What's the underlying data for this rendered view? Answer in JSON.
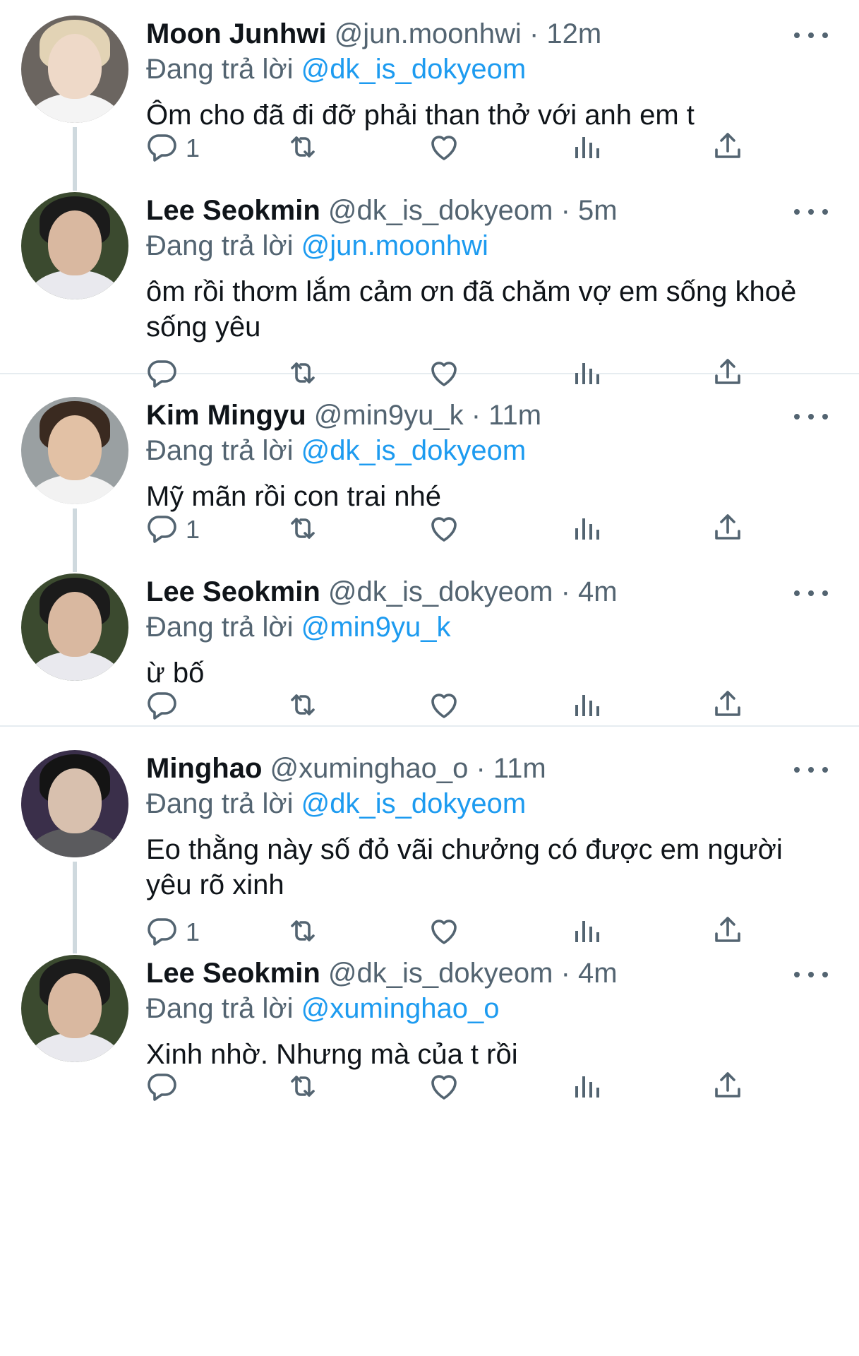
{
  "reply_prefix": "Đang trả lời",
  "threads": [
    {
      "tweets": [
        {
          "name": "Moon Junhwi",
          "handle": "@jun.moonhwi",
          "time": "12m",
          "reply_to": "@dk_is_dokyeom",
          "text": "Ôm cho đã đi đỡ phải than thở với anh em t",
          "reply_count": "1",
          "avatar": {
            "bg": "#6b6560",
            "face": "#eed9c8",
            "hair": "#e2d3b5",
            "body": "#f4f4f4"
          }
        },
        {
          "name": "Lee Seokmin",
          "handle": "@dk_is_dokyeom",
          "time": "5m",
          "reply_to": "@jun.moonhwi",
          "text": "ôm rồi thơm lắm cảm ơn đã chăm vợ em sống khoẻ sống yêu",
          "reply_count": "",
          "avatar": {
            "bg": "#3b4a2f",
            "face": "#d9b8a0",
            "hair": "#1b1b1b",
            "body": "#e9e9ee"
          }
        }
      ]
    },
    {
      "tweets": [
        {
          "name": "Kim Mingyu",
          "handle": "@min9yu_k",
          "time": "11m",
          "reply_to": "@dk_is_dokyeom",
          "text": "Mỹ mãn rồi con trai nhé",
          "reply_count": "1",
          "avatar": {
            "bg": "#9aa0a2",
            "face": "#e2c1a5",
            "hair": "#3a2a20",
            "body": "#f2f2f2"
          }
        },
        {
          "name": "Lee Seokmin",
          "handle": "@dk_is_dokyeom",
          "time": "4m",
          "reply_to": "@min9yu_k",
          "text": "ừ bố",
          "reply_count": "",
          "avatar": {
            "bg": "#3b4a2f",
            "face": "#d9b8a0",
            "hair": "#1b1b1b",
            "body": "#e9e9ee"
          }
        }
      ]
    },
    {
      "tweets": [
        {
          "name": "Minghao",
          "handle": "@xuminghao_o",
          "time": "11m",
          "reply_to": "@dk_is_dokyeom",
          "text": "Eo thằng này số đỏ vãi chưởng có được em người yêu rõ xinh",
          "reply_count": "1",
          "avatar": {
            "bg": "#3a2f4a",
            "face": "#d8c0ae",
            "hair": "#141414",
            "body": "#5b5b5e"
          }
        },
        {
          "name": "Lee Seokmin",
          "handle": "@dk_is_dokyeom",
          "time": "4m",
          "reply_to": "@xuminghao_o",
          "text": "Xinh nhờ. Nhưng mà của t rồi",
          "reply_count": "",
          "avatar": {
            "bg": "#3b4a2f",
            "face": "#d9b8a0",
            "hair": "#1b1b1b",
            "body": "#e9e9ee"
          }
        }
      ]
    }
  ],
  "colors": {
    "link": "#1d9bf0",
    "secondary": "#536471",
    "thread_line": "#cfd9de",
    "divider": "#e6ecf0"
  },
  "icons": [
    "reply-icon",
    "retweet-icon",
    "like-icon",
    "views-icon",
    "share-icon",
    "more-icon"
  ]
}
